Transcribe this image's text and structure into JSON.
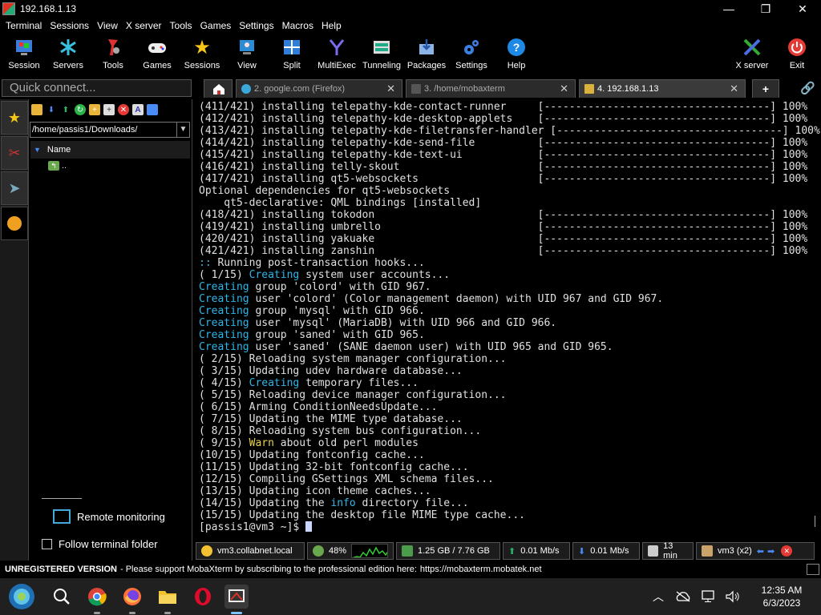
{
  "window": {
    "title": "192.168.1.13",
    "minimize_glyph": "—",
    "maximize_glyph": "❐",
    "close_glyph": "✕"
  },
  "menu": [
    "Terminal",
    "Sessions",
    "View",
    "X server",
    "Tools",
    "Games",
    "Settings",
    "Macros",
    "Help"
  ],
  "toolbar": {
    "items": [
      {
        "label": "Session",
        "icon": "session-icon"
      },
      {
        "label": "Servers",
        "icon": "servers-icon"
      },
      {
        "label": "Tools",
        "icon": "tools-icon"
      },
      {
        "label": "Games",
        "icon": "games-icon"
      },
      {
        "label": "Sessions",
        "icon": "star-icon"
      },
      {
        "label": "View",
        "icon": "view-icon"
      },
      {
        "label": "Split",
        "icon": "split-icon"
      },
      {
        "label": "MultiExec",
        "icon": "multiexec-icon"
      },
      {
        "label": "Tunneling",
        "icon": "tunneling-icon"
      },
      {
        "label": "Packages",
        "icon": "packages-icon"
      },
      {
        "label": "Settings",
        "icon": "settings-icon"
      },
      {
        "label": "Help",
        "icon": "help-icon"
      }
    ],
    "xserver_label": "X server",
    "exit_label": "Exit"
  },
  "quick_connect": {
    "placeholder": "Quick connect..."
  },
  "tabs": [
    {
      "label": "2. google.com (Firefox)",
      "icon": "firefox-icon",
      "active": false
    },
    {
      "label": "3. /home/mobaxterm",
      "icon": "terminal-icon",
      "active": false
    },
    {
      "label": "4. 192.168.1.13",
      "icon": "ssh-key-icon",
      "active": true
    }
  ],
  "sftp": {
    "path": "/home/passis1/Downloads/",
    "column_name": "Name",
    "parent_dir": ".."
  },
  "remote_monitoring_label": "Remote monitoring",
  "follow_terminal_label": "Follow terminal folder",
  "terminal": {
    "lines": [
      [
        {
          "t": "(411/421) installing telepathy-kde-contact-runner     [------------------------------------] 100%"
        }
      ],
      [
        {
          "t": "(412/421) installing telepathy-kde-desktop-applets    [------------------------------------] 100%"
        }
      ],
      [
        {
          "t": "(413/421) installing telepathy-kde-filetransfer-handler [------------------------------------] 100%"
        }
      ],
      [
        {
          "t": "(414/421) installing telepathy-kde-send-file          [------------------------------------] 100%"
        }
      ],
      [
        {
          "t": "(415/421) installing telepathy-kde-text-ui            [------------------------------------] 100%"
        }
      ],
      [
        {
          "t": "(416/421) installing telly-skout                      [------------------------------------] 100%"
        }
      ],
      [
        {
          "t": "(417/421) installing qt5-websockets                   [------------------------------------] 100%"
        }
      ],
      [
        {
          "t": "Optional dependencies for qt5-websockets"
        }
      ],
      [
        {
          "t": "    qt5-declarative: QML bindings [installed]"
        }
      ],
      [
        {
          "t": "(418/421) installing tokodon                          [------------------------------------] 100%"
        }
      ],
      [
        {
          "t": "(419/421) installing umbrello                         [------------------------------------] 100%"
        }
      ],
      [
        {
          "t": "(420/421) installing yakuake                          [------------------------------------] 100%"
        }
      ],
      [
        {
          "t": "(421/421) installing zanshin                          [------------------------------------] 100%"
        }
      ],
      [
        {
          "t": ":: Running post-transaction hooks...",
          "c": "cyan-prefix"
        }
      ],
      [
        {
          "t": "( 1/15) "
        },
        {
          "t": "Creating",
          "c": "cyan"
        },
        {
          "t": " system user accounts..."
        }
      ],
      [
        {
          "t": "Creating",
          "c": "cyan"
        },
        {
          "t": " group 'colord' with GID 967."
        }
      ],
      [
        {
          "t": "Creating",
          "c": "cyan"
        },
        {
          "t": " user 'colord' (Color management daemon) with UID 967 and GID 967."
        }
      ],
      [
        {
          "t": "Creating",
          "c": "cyan"
        },
        {
          "t": " group 'mysql' with GID 966."
        }
      ],
      [
        {
          "t": "Creating",
          "c": "cyan"
        },
        {
          "t": " user 'mysql' (MariaDB) with UID 966 and GID 966."
        }
      ],
      [
        {
          "t": "Creating",
          "c": "cyan"
        },
        {
          "t": " group 'saned' with GID 965."
        }
      ],
      [
        {
          "t": "Creating",
          "c": "cyan"
        },
        {
          "t": " user 'saned' (SANE daemon user) with UID 965 and GID 965."
        }
      ],
      [
        {
          "t": "( 2/15) Reloading system manager configuration..."
        }
      ],
      [
        {
          "t": "( 3/15) Updating udev hardware database..."
        }
      ],
      [
        {
          "t": "( 4/15) "
        },
        {
          "t": "Creating",
          "c": "cyan"
        },
        {
          "t": " temporary files..."
        }
      ],
      [
        {
          "t": "( 5/15) Reloading device manager configuration..."
        }
      ],
      [
        {
          "t": "( 6/15) Arming ConditionNeedsUpdate..."
        }
      ],
      [
        {
          "t": "( 7/15) Updating the MIME type database..."
        }
      ],
      [
        {
          "t": "( 8/15) Reloading system bus configuration..."
        }
      ],
      [
        {
          "t": "( 9/15) "
        },
        {
          "t": "Warn",
          "c": "yellow"
        },
        {
          "t": " about old perl modules"
        }
      ],
      [
        {
          "t": "(10/15) Updating fontconfig cache..."
        }
      ],
      [
        {
          "t": "(11/15) Updating 32-bit fontconfig cache..."
        }
      ],
      [
        {
          "t": "(12/15) Compiling GSettings XML schema files..."
        }
      ],
      [
        {
          "t": "(13/15) Updating icon theme caches..."
        }
      ],
      [
        {
          "t": "(14/15) Updating the "
        },
        {
          "t": "info",
          "c": "cyan"
        },
        {
          "t": " directory file..."
        }
      ],
      [
        {
          "t": "(15/15) Updating the desktop file MIME type cache..."
        }
      ],
      [
        {
          "t": "[passis1@vm3 ~]$ "
        },
        {
          "c": "cursor"
        }
      ]
    ]
  },
  "status": {
    "host": "vm3.collabnet.local",
    "cpu": "48%",
    "memory": "1.25 GB / 7.76 GB",
    "upload": "0.01 Mb/s",
    "download": "0.01 Mb/s",
    "uptime": "13 min",
    "user": "vm3 (x2)"
  },
  "unregistered": {
    "title": "UNREGISTERED VERSION",
    "message": "-  Please support MobaXterm by subscribing to the professional edition here:",
    "link": "https://mobaxterm.mobatek.net"
  },
  "taskbar": {
    "apps": [
      "start-icon",
      "search-icon",
      "chrome-icon",
      "firefox-icon",
      "file-explorer-icon",
      "opera-icon",
      "mobaxterm-icon"
    ],
    "time": "12:35 AM",
    "date": "6/3/2023"
  },
  "colors": {
    "accent_cyan": "#2fb6e8",
    "warn_yellow": "#e8d44d",
    "exit_red": "#e53935"
  }
}
